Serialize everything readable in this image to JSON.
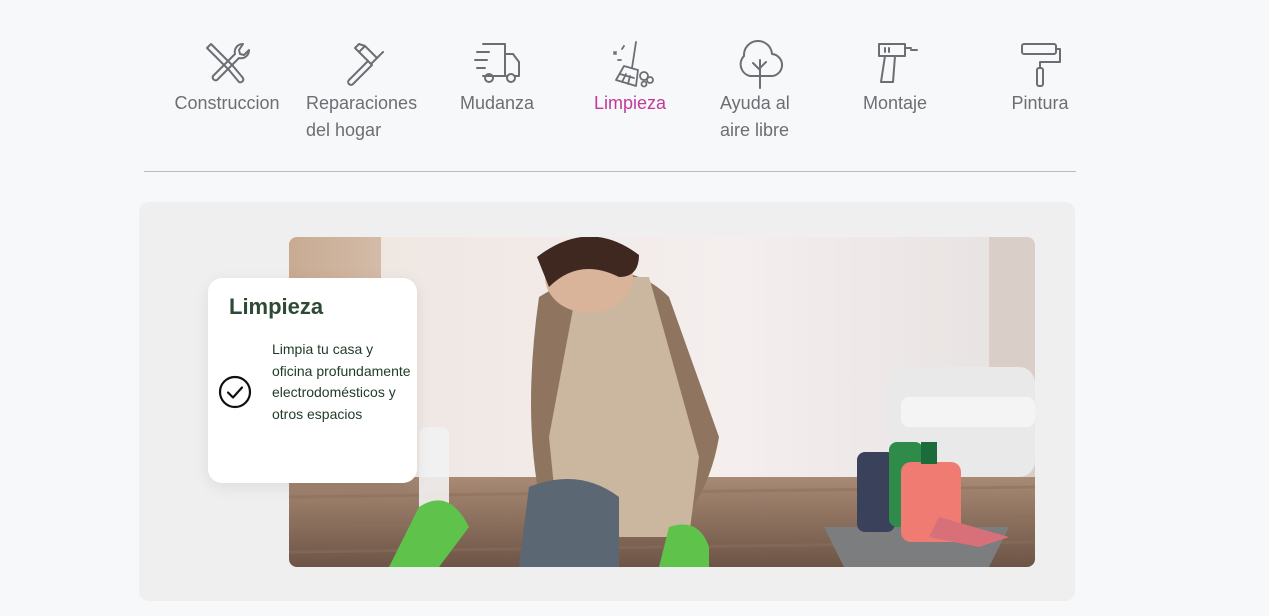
{
  "categories": [
    {
      "label": "Construccion",
      "icon": "tools-icon",
      "active": false
    },
    {
      "label": "Reparaciones\ndel hogar",
      "icon": "hammer-icon",
      "active": false
    },
    {
      "label": "Mudanza",
      "icon": "truck-icon",
      "active": false
    },
    {
      "label": "Limpieza",
      "icon": "broom-icon",
      "active": true
    },
    {
      "label": "Ayuda al\naire libre",
      "icon": "tree-icon",
      "active": false
    },
    {
      "label": "Montaje",
      "icon": "drill-icon",
      "active": false
    },
    {
      "label": "Pintura",
      "icon": "paint-roller-icon",
      "active": false
    }
  ],
  "feature": {
    "title": "Limpieza",
    "description": "Limpia tu casa y oficina profundamente electrodomésticos  y otros espacios",
    "check_icon": "check-circle-icon",
    "image": "woman-cleaning-floor-photo"
  },
  "colors": {
    "active_tab": "#c2399c",
    "tab_text": "#6b6f73",
    "card_title": "#2d4a34",
    "panel_bg": "#efefef"
  }
}
